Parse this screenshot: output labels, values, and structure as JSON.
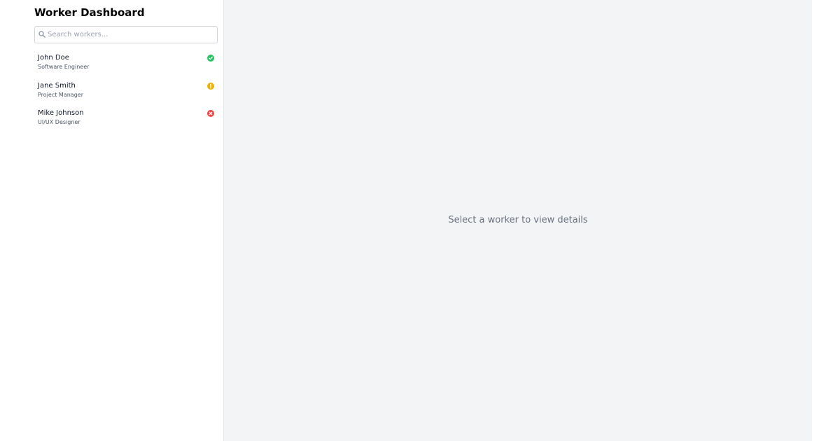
{
  "sidebar": {
    "title": "Worker Dashboard",
    "search": {
      "placeholder": "Search workers...",
      "value": "",
      "icon": "search-icon"
    },
    "workers": [
      {
        "name": "John Doe",
        "role": "Software Engineer",
        "status": "active",
        "status_icon": "check-circle-icon",
        "status_color": "#22c55e"
      },
      {
        "name": "Jane Smith",
        "role": "Project Manager",
        "status": "warning",
        "status_icon": "exclamation-circle-icon",
        "status_color": "#eab308"
      },
      {
        "name": "Mike Johnson",
        "role": "UI/UX Designer",
        "status": "inactive",
        "status_icon": "x-circle-icon",
        "status_color": "#ef4444"
      }
    ]
  },
  "main": {
    "empty_message": "Select a worker to view details"
  },
  "colors": {
    "sidebar_bg": "#ffffff",
    "main_bg": "#f3f4f6",
    "border": "#e5e7eb",
    "muted_text": "#6b7280"
  }
}
